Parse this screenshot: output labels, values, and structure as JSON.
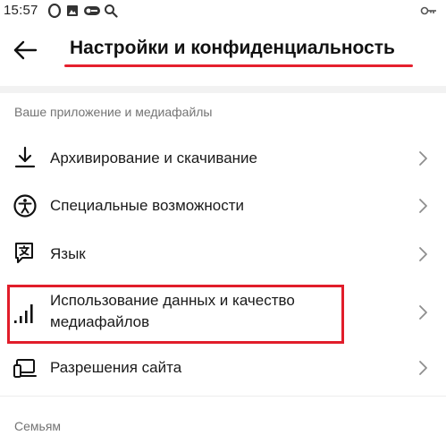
{
  "status_bar": {
    "time": "15:57",
    "icons": [
      "opera-icon",
      "image-icon",
      "vpn-key-icon",
      "search-icon",
      "key-icon"
    ]
  },
  "header": {
    "back_icon": "arrow-left-icon",
    "title": "Настройки и конфиденциальность"
  },
  "sections": [
    {
      "header": "Ваше приложение и медиафайлы",
      "items": [
        {
          "label": "Архивирование и скачивание",
          "icon": "download-icon"
        },
        {
          "label": "Специальные возможности",
          "icon": "accessibility-icon"
        },
        {
          "label": "Язык",
          "icon": "language-icon"
        },
        {
          "label_line1": "Использование данных и качество",
          "label_line2": "медиафайлов",
          "icon": "signal-bars-icon"
        },
        {
          "label": "Разрешения сайта",
          "icon": "devices-icon"
        }
      ]
    },
    {
      "header": "Семьям",
      "items": []
    }
  ],
  "colors": {
    "highlight": "#e11d2a",
    "section_header": "#737373",
    "text": "#1a1a1a",
    "chevron": "#8e8e8e"
  }
}
